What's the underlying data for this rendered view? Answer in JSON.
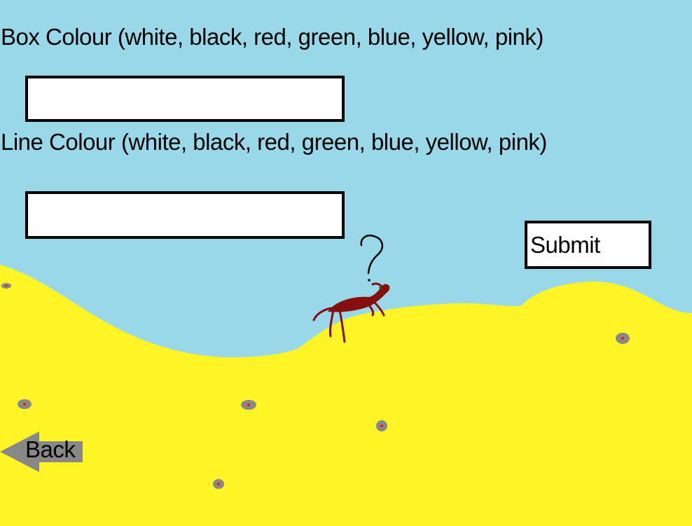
{
  "form": {
    "box_colour_label": "Box Colour (white, black, red, green, blue, yellow, pink)",
    "box_colour_value": "",
    "line_colour_label": "Line Colour (white, black, red, green, blue, yellow, pink)",
    "line_colour_value": "",
    "submit_label": "Submit"
  },
  "navigation": {
    "back_label": "Back"
  },
  "scene": {
    "sky_color": "#99d8e9",
    "sand_color": "#fff426",
    "creature_color": "#850f0f",
    "pebble_color": "#888888",
    "pebble_dot_color": "#ed1c24",
    "back_arrow_color": "#888888"
  }
}
